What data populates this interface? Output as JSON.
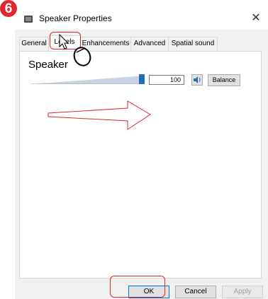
{
  "step_number": "6",
  "window": {
    "title": "Speaker Properties",
    "close_symbol": "✕"
  },
  "tabs": [
    {
      "label": "General",
      "active": false
    },
    {
      "label": "Levels",
      "active": true
    },
    {
      "label": "Enhancements",
      "active": false
    },
    {
      "label": "Advanced",
      "active": false
    },
    {
      "label": "Spatial sound",
      "active": false
    }
  ],
  "levels": {
    "device_label": "Speaker",
    "volume_value": "100",
    "volume_fraction": 1.0,
    "balance_label": "Balance",
    "mute_icon": "speaker-icon"
  },
  "buttons": {
    "ok_label": "OK",
    "cancel_label": "Cancel",
    "apply_label": "Apply"
  },
  "colors": {
    "annotation_red": "#e0262e",
    "slider_blue": "#1f6fb5"
  }
}
